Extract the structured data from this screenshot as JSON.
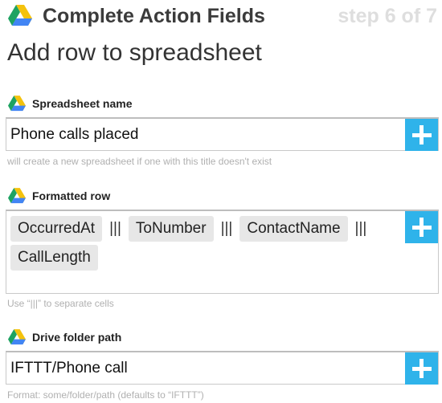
{
  "header": {
    "title": "Complete Action Fields",
    "step": "step 6 of 7"
  },
  "page_title": "Add row to spreadsheet",
  "fields": [
    {
      "label": "Spreadsheet name",
      "value": "Phone calls placed",
      "hint": "will create a new spreadsheet if one with this title doesn't exist"
    },
    {
      "label": "Formatted row",
      "tokens": [
        "OccurredAt",
        "ToNumber",
        "ContactName",
        "CallLength"
      ],
      "separator": "|||",
      "hint": "Use “|||” to separate cells"
    },
    {
      "label": "Drive folder path",
      "value": "IFTTT/Phone call",
      "hint": "Format: some/folder/path (defaults to “IFTTT”)"
    }
  ],
  "icons": {
    "drive": "google-drive-icon",
    "add": "plus-icon"
  },
  "colors": {
    "accent": "#2fb3ea",
    "drive_yellow": "#f4c20d",
    "drive_green": "#1ea362",
    "drive_blue": "#4285f4"
  }
}
